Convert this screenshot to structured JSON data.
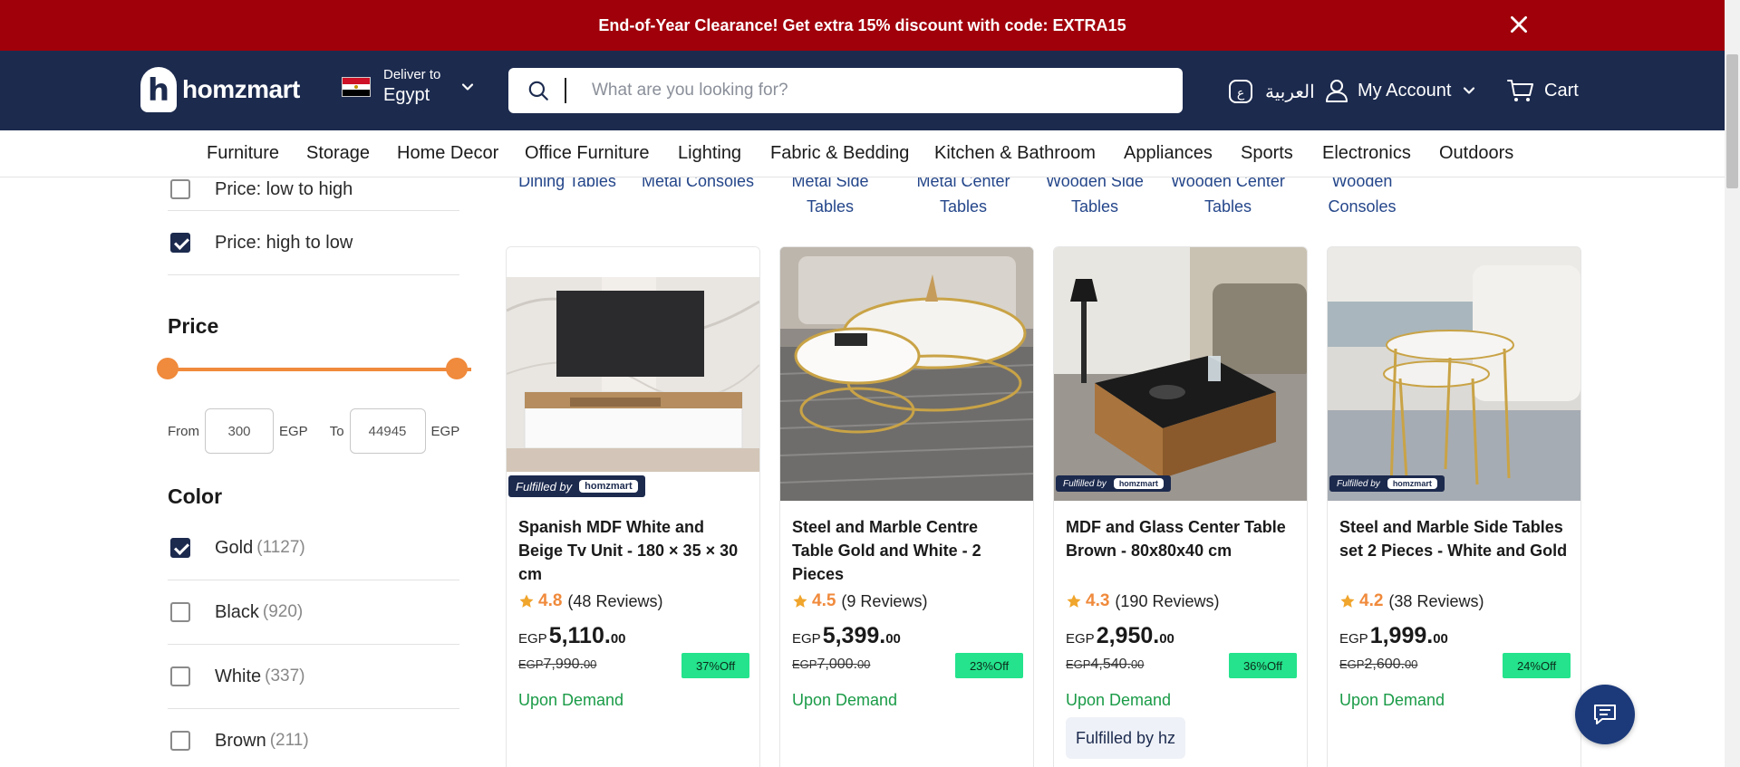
{
  "banner": {
    "text": "End-of-Year Clearance! Get extra 15% discount with code: EXTRA15",
    "bg_color": "#a0000a"
  },
  "header": {
    "brand": "homzmart",
    "deliver_label": "Deliver to",
    "deliver_country": "Egypt",
    "search_placeholder": "What are you looking for?",
    "language": "العربية",
    "account": "My Account",
    "cart": "Cart",
    "bg_color": "#1c2a4e"
  },
  "nav": {
    "items": [
      "Furniture",
      "Storage",
      "Home Decor",
      "Office Furniture",
      "Lighting",
      "Fabric & Bedding",
      "Kitchen & Bathroom",
      "Appliances",
      "Sports",
      "Electronics",
      "Outdoors"
    ]
  },
  "sidebar": {
    "sort_options": [
      {
        "label": "Price: low to high",
        "checked": false
      },
      {
        "label": "Price: high to low",
        "checked": true
      }
    ],
    "price_title": "Price",
    "price_from_label": "From",
    "price_from": "300",
    "price_to_label": "To",
    "price_to": "44945",
    "currency": "EGP",
    "color_title": "Color",
    "colors": [
      {
        "label": "Gold",
        "count": "(1127)",
        "checked": true
      },
      {
        "label": "Black",
        "count": "(920)",
        "checked": false
      },
      {
        "label": "White",
        "count": "(337)",
        "checked": false
      },
      {
        "label": "Brown",
        "count": "(211)",
        "checked": false
      }
    ],
    "accent_color": "#f08a3c"
  },
  "subcategories": [
    {
      "line1": "Dining Tables",
      "line2": ""
    },
    {
      "line1": "Metal Consoles",
      "line2": ""
    },
    {
      "line1": "Metal Side",
      "line2": "Tables"
    },
    {
      "line1": "Metal Center",
      "line2": "Tables"
    },
    {
      "line1": "Wooden Side",
      "line2": "Tables"
    },
    {
      "line1": "Wooden Center",
      "line2": "Tables"
    },
    {
      "line1": "Wooden",
      "line2": "Consoles"
    }
  ],
  "products": [
    {
      "title": "Spanish MDF White and Beige Tv Unit - 180 × 35 × 30 cm",
      "rating": "4.8",
      "reviews": "(48 Reviews)",
      "currency": "EGP",
      "price": "5,110.",
      "price_dec": "00",
      "old_price": "7,990.",
      "old_dec": "00",
      "discount": "37%Off",
      "availability": "Upon Demand",
      "fulfilled_badge": "Fulfilled by",
      "fulfilled_tag": ""
    },
    {
      "title": "Steel and Marble Centre Table Gold and White - 2 Pieces",
      "rating": "4.5",
      "reviews": "(9 Reviews)",
      "currency": "EGP",
      "price": "5,399.",
      "price_dec": "00",
      "old_price": "7,000.",
      "old_dec": "00",
      "discount": "23%Off",
      "availability": "Upon Demand",
      "fulfilled_badge": "",
      "fulfilled_tag": ""
    },
    {
      "title": "MDF and Glass Center Table Brown - 80x80x40 cm",
      "rating": "4.3",
      "reviews": "(190 Reviews)",
      "currency": "EGP",
      "price": "2,950.",
      "price_dec": "00",
      "old_price": "4,540.",
      "old_dec": "00",
      "discount": "36%Off",
      "availability": "Upon Demand",
      "fulfilled_badge": "Fulfilled by",
      "fulfilled_tag": "Fulfilled by hz"
    },
    {
      "title": "Steel and Marble Side Tables set 2 Pieces - White and Gold",
      "rating": "4.2",
      "reviews": "(38 Reviews)",
      "currency": "EGP",
      "price": "1,999.",
      "price_dec": "00",
      "old_price": "2,600.",
      "old_dec": "00",
      "discount": "24%Off",
      "availability": "Upon Demand",
      "fulfilled_badge": "Fulfilled by",
      "fulfilled_tag": ""
    }
  ],
  "icons": {
    "close": "close-icon",
    "search": "search-icon",
    "language": "language-icon",
    "user": "user-icon",
    "chevron": "chevron-down-icon",
    "cart": "cart-icon",
    "star": "star-icon",
    "chat": "chat-icon"
  },
  "colors": {
    "discount_badge": "#24e38c",
    "availability": "#1a9b47",
    "rating": "#f08a3c",
    "link": "#24468a"
  }
}
